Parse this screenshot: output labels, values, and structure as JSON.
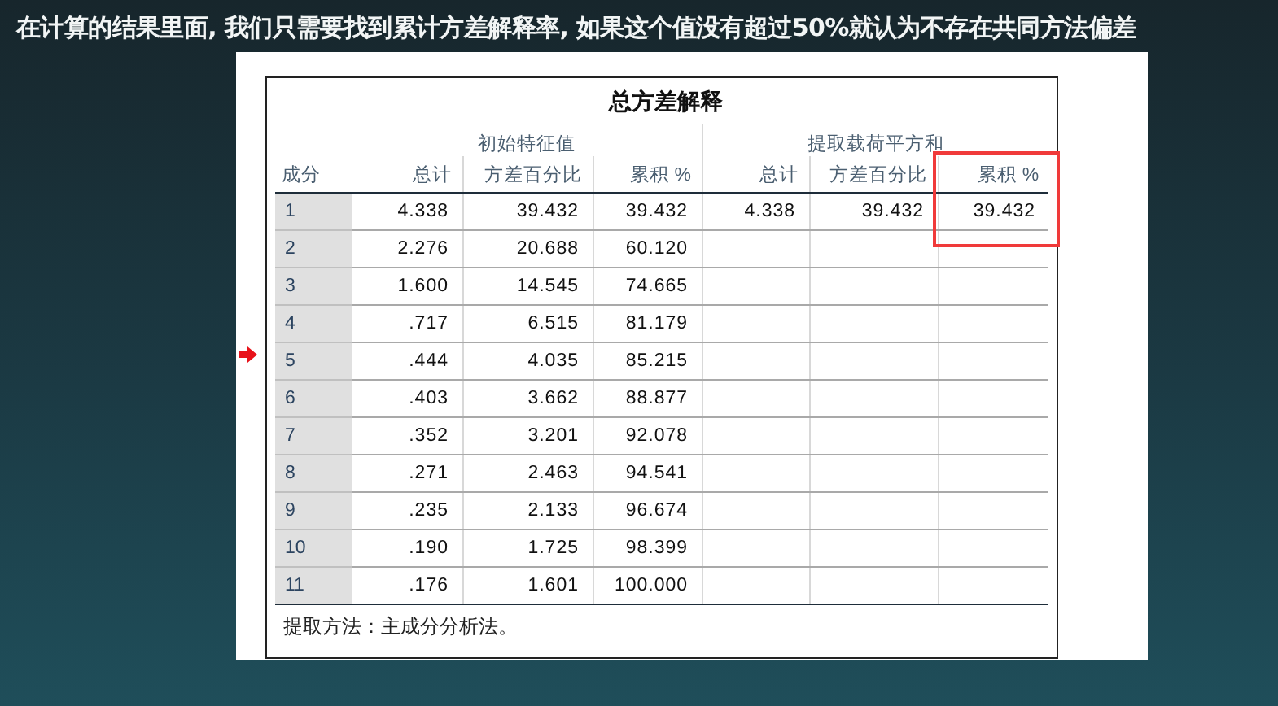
{
  "heading": "在计算的结果里面, 我们只需要找到累计方差解释率, 如果这个值没有超过50%就认为不存在共同方法偏差",
  "table": {
    "title": "总方差解释",
    "groups": [
      "初始特征值",
      "提取载荷平方和"
    ],
    "columns": [
      "成分",
      "总计",
      "方差百分比",
      "累积 %",
      "总计",
      "方差百分比",
      "累积 %"
    ],
    "rows": [
      {
        "component": "1",
        "initial": [
          "4.338",
          "39.432",
          "39.432"
        ],
        "extraction": [
          "4.338",
          "39.432",
          "39.432"
        ]
      },
      {
        "component": "2",
        "initial": [
          "2.276",
          "20.688",
          "60.120"
        ]
      },
      {
        "component": "3",
        "initial": [
          "1.600",
          "14.545",
          "74.665"
        ]
      },
      {
        "component": "4",
        "initial": [
          ".717",
          "6.515",
          "81.179"
        ]
      },
      {
        "component": "5",
        "initial": [
          ".444",
          "4.035",
          "85.215"
        ]
      },
      {
        "component": "6",
        "initial": [
          ".403",
          "3.662",
          "88.877"
        ]
      },
      {
        "component": "7",
        "initial": [
          ".352",
          "3.201",
          "92.078"
        ]
      },
      {
        "component": "8",
        "initial": [
          ".271",
          "2.463",
          "94.541"
        ]
      },
      {
        "component": "9",
        "initial": [
          ".235",
          "2.133",
          "96.674"
        ]
      },
      {
        "component": "10",
        "initial": [
          ".190",
          "1.725",
          "98.399"
        ]
      },
      {
        "component": "11",
        "initial": [
          ".176",
          "1.601",
          "100.000"
        ]
      }
    ],
    "footnote": "提取方法：主成分分析法。"
  }
}
